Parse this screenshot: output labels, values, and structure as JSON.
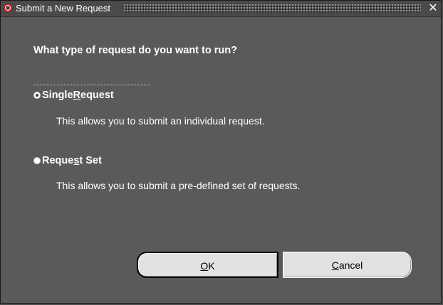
{
  "window": {
    "title": "Submit a New Request",
    "close_glyph": "✕",
    "app_icon": "oracle-icon"
  },
  "dialog": {
    "question": "What type of request do you want to run?",
    "options": [
      {
        "label_pre": "Single ",
        "label_mnemonic": "R",
        "label_post": "equest",
        "selected": false,
        "description": "This allows you to submit an individual request."
      },
      {
        "label_pre": "Reque",
        "label_mnemonic": "s",
        "label_post": "t Set",
        "selected": false,
        "description": "This allows you to submit a pre-defined set of requests."
      }
    ]
  },
  "buttons": {
    "ok_mnemonic": "O",
    "ok_post": "K",
    "cancel_mnemonic": "C",
    "cancel_post": "ancel"
  }
}
